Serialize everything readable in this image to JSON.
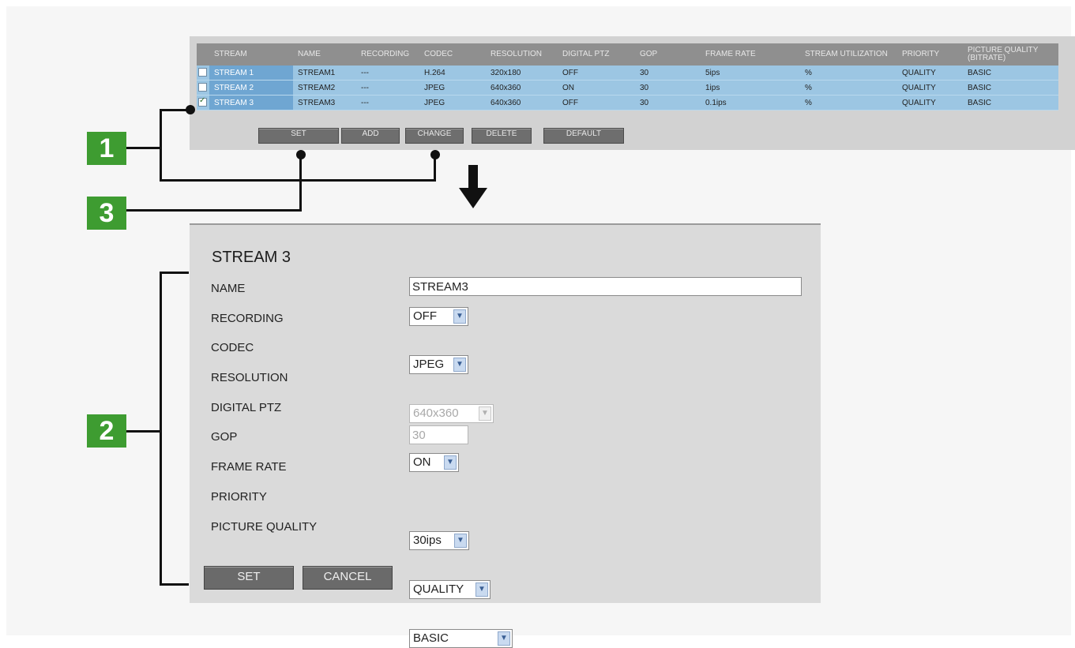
{
  "table": {
    "headers": [
      "STREAM",
      "NAME",
      "RECORDING",
      "CODEC",
      "RESOLUTION",
      "DIGITAL PTZ",
      "GOP",
      "FRAME RATE",
      "STREAM UTILIZATION",
      "PRIORITY",
      "PICTURE QUALITY (BITRATE)"
    ],
    "rows": [
      {
        "checked": false,
        "stream": "STREAM 1",
        "name": "STREAM1",
        "recording": "---",
        "codec": "H.264",
        "resolution": "320x180",
        "ptz": "OFF",
        "gop": "30",
        "framerate": "5ips",
        "utilization": "%",
        "priority": "QUALITY",
        "quality": "BASIC"
      },
      {
        "checked": false,
        "stream": "STREAM 2",
        "name": "STREAM2",
        "recording": "---",
        "codec": "JPEG",
        "resolution": "640x360",
        "ptz": "ON",
        "gop": "30",
        "framerate": "1ips",
        "utilization": "%",
        "priority": "QUALITY",
        "quality": "BASIC"
      },
      {
        "checked": true,
        "stream": "STREAM 3",
        "name": "STREAM3",
        "recording": "---",
        "codec": "JPEG",
        "resolution": "640x360",
        "ptz": "OFF",
        "gop": "30",
        "framerate": "0.1ips",
        "utilization": "%",
        "priority": "QUALITY",
        "quality": "BASIC"
      }
    ],
    "buttons": {
      "set": "SET",
      "add": "ADD",
      "change": "CHANGE",
      "delete": "DELETE",
      "default": "DEFAULT"
    }
  },
  "callouts": {
    "one": "1",
    "two": "2",
    "three": "3"
  },
  "edit": {
    "title": "STREAM 3",
    "labels": {
      "name": "NAME",
      "recording": "RECORDING",
      "codec": "CODEC",
      "resolution": "RESOLUTION",
      "ptz": "DIGITAL PTZ",
      "gop": "GOP",
      "framerate": "FRAME RATE",
      "priority": "PRIORITY",
      "quality": "PICTURE QUALITY"
    },
    "values": {
      "name": "STREAM3",
      "recording": "OFF",
      "codec": "JPEG",
      "resolution": "640x360",
      "ptz": "ON",
      "gop": "30",
      "framerate": "30ips",
      "priority": "QUALITY",
      "quality": "BASIC"
    },
    "buttons": {
      "set": "SET",
      "cancel": "CANCEL"
    }
  },
  "colors": {
    "accent_green": "#3e9c31",
    "row_blue": "#9cc6e3",
    "stream_cell_blue": "#6fa6d2",
    "header_gray": "#8f8f8f"
  },
  "icons": {
    "dropdown": "chevron-down-icon",
    "arrow": "arrow-down-icon"
  }
}
